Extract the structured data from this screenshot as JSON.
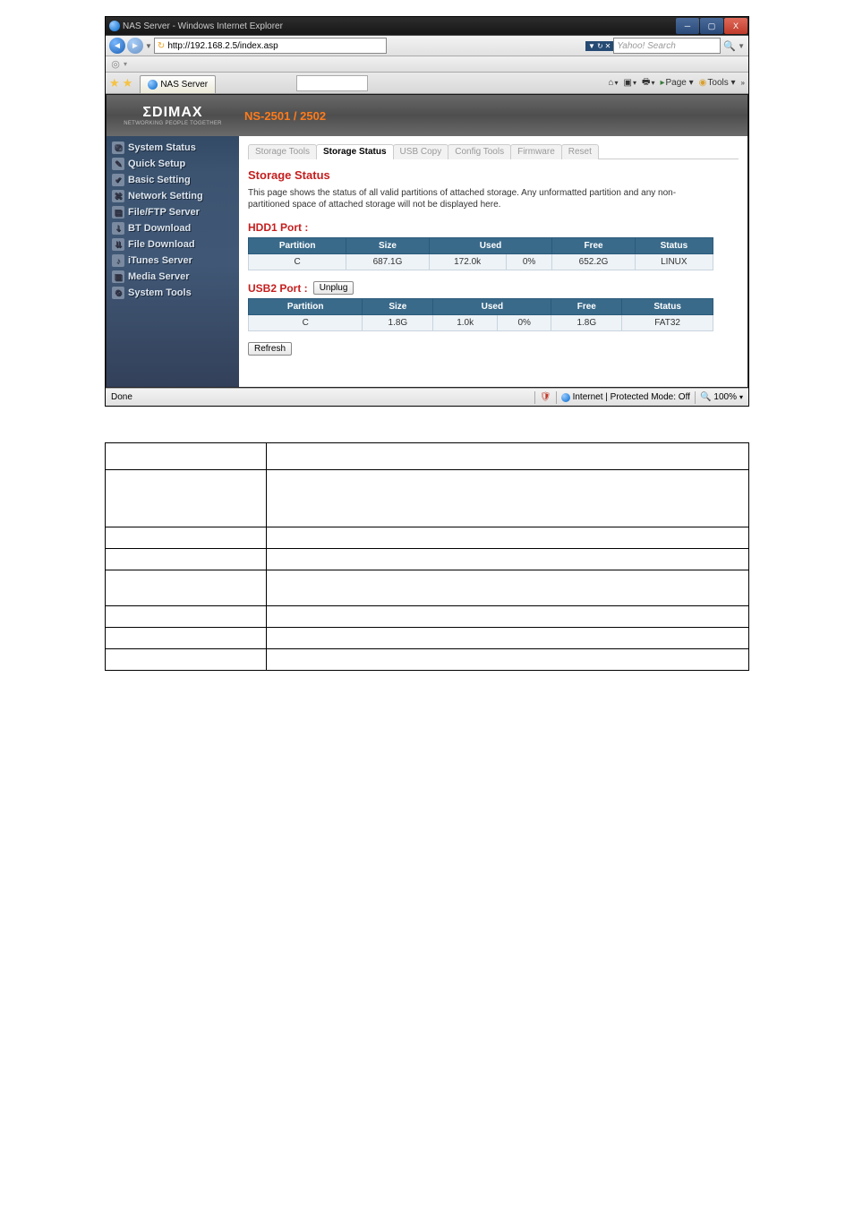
{
  "window": {
    "title": "NAS Server - Windows Internet Explorer",
    "min": "─",
    "max": "▢",
    "close": "X"
  },
  "nav": {
    "back_glyph": "◄",
    "fwd_glyph": "►",
    "url": "http://192.168.2.5/index.asp",
    "search_placeholder": "Yahoo! Search",
    "splitters": {
      "a": "▼",
      "b": "↻",
      "c": "✕"
    },
    "mag": "🔍"
  },
  "tabrow": {
    "tab_label": "NAS Server",
    "toolbar": {
      "home": "⌂",
      "feed": "▣",
      "print": "🖶",
      "page": "Page ▾",
      "tools": "Tools ▾"
    }
  },
  "brand": {
    "logo": "ΣDIMAX",
    "tagline": "NETWORKING PEOPLE TOGETHER",
    "model": "NS-2501 / 2502"
  },
  "sidebar": {
    "items": [
      {
        "label": "System Status"
      },
      {
        "label": "Quick Setup"
      },
      {
        "label": "Basic Setting"
      },
      {
        "label": "Network Setting"
      },
      {
        "label": "File/FTP Server"
      },
      {
        "label": "BT Download"
      },
      {
        "label": "File Download"
      },
      {
        "label": "iTunes Server"
      },
      {
        "label": "Media Server"
      },
      {
        "label": "System Tools"
      }
    ]
  },
  "subtabs": {
    "items": [
      {
        "label": "Storage Tools"
      },
      {
        "label": "Storage Status"
      },
      {
        "label": "USB Copy"
      },
      {
        "label": "Config Tools"
      },
      {
        "label": "Firmware"
      },
      {
        "label": "Reset"
      }
    ],
    "active_index": 1
  },
  "page": {
    "title": "Storage Status",
    "desc": "This page shows the status of all valid partitions of attached storage. Any unformatted partition and any non-partitioned space of attached storage will not be displayed here.",
    "port_a": "HDD1 Port :",
    "port_b": "USB2 Port :",
    "unplug": "Unplug",
    "refresh": "Refresh",
    "headers": {
      "partition": "Partition",
      "size": "Size",
      "used": "Used",
      "free": "Free",
      "status": "Status"
    },
    "table_a": {
      "partition": "C",
      "size": "687.1G",
      "used_k": "172.0k",
      "used_pct": "0%",
      "free": "652.2G",
      "status": "LINUX"
    },
    "table_b": {
      "partition": "C",
      "size": "1.8G",
      "used_k": "1.0k",
      "used_pct": "0%",
      "free": "1.8G",
      "status": "FAT32"
    }
  },
  "status": {
    "left": "Done",
    "zone": "Internet | Protected Mode: Off",
    "zoom": "100%"
  },
  "chart_data": {
    "type": "table",
    "title": "Storage Status",
    "ports": [
      {
        "port": "HDD1 Port",
        "partition": "C",
        "size": "687.1G",
        "used_bytes": "172.0k",
        "used_pct": 0,
        "free": "652.2G",
        "filesystem": "LINUX"
      },
      {
        "port": "USB2 Port",
        "partition": "C",
        "size": "1.8G",
        "used_bytes": "1.0k",
        "used_pct": 0,
        "free": "1.8G",
        "filesystem": "FAT32"
      }
    ]
  }
}
